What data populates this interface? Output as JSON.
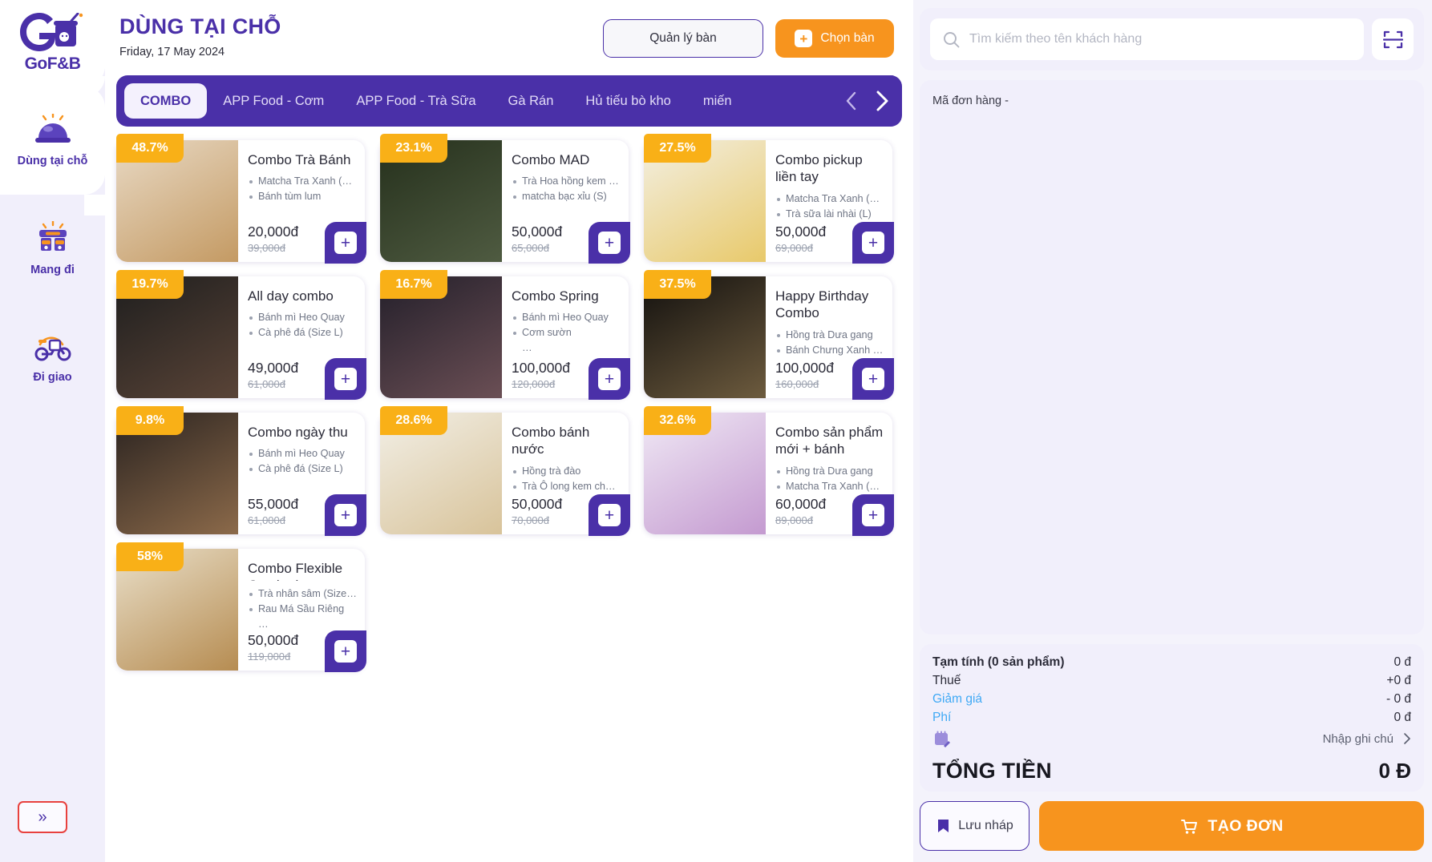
{
  "brand": {
    "name": "GoF&B",
    "logo_icon": "gofnb-logo-icon"
  },
  "sidebar": {
    "items": [
      {
        "label": "Dùng tại chỗ",
        "icon": "dine-in-icon",
        "active": true
      },
      {
        "label": "Mang đi",
        "icon": "takeaway-icon",
        "active": false
      },
      {
        "label": "Đi giao",
        "icon": "delivery-icon",
        "active": false
      }
    ],
    "expand_label": "»"
  },
  "header": {
    "title": "DÙNG TẠI CHỖ",
    "date": "Friday, 17 May 2024",
    "manage_table_label": "Quản lý bàn",
    "choose_table_label": "Chọn bàn"
  },
  "tabs": [
    {
      "label": "COMBO",
      "active": true
    },
    {
      "label": "APP Food - Cơm",
      "active": false
    },
    {
      "label": "APP Food - Trà Sữa",
      "active": false
    },
    {
      "label": "Gà Rán",
      "active": false
    },
    {
      "label": "Hủ tiếu bò kho",
      "active": false
    },
    {
      "label": "miến",
      "active": false
    }
  ],
  "products": [
    {
      "discount": "48.7%",
      "name": "Combo Trà Bánh",
      "options": [
        "Matcha Tra Xanh (Size S)",
        "Bánh tùm lum"
      ],
      "price": "20,000đ",
      "old_price": "39,000đ",
      "img_from": "#e8d9c4",
      "img_to": "#c49a63"
    },
    {
      "discount": "23.1%",
      "name": "Combo MAD",
      "options": [
        "Trà Hoa hồng kem che…",
        "matcha bạc xỉu (S)"
      ],
      "price": "50,000đ",
      "old_price": "65,000đ",
      "img_from": "#25301c",
      "img_to": "#4f5b41"
    },
    {
      "discount": "27.5%",
      "name": "Combo pickup liền tay",
      "options": [
        "Matcha Tra Xanh (Size S)",
        "Trà sữa lài nhài (L)"
      ],
      "price": "50,000đ",
      "old_price": "69,000đ",
      "img_from": "#f3efe2",
      "img_to": "#e8c96a"
    },
    {
      "discount": "19.7%",
      "name": "All day combo",
      "options": [
        "Bánh mì Heo Quay",
        "Cà phê đá (Size L)"
      ],
      "price": "49,000đ",
      "old_price": "61,000đ",
      "img_from": "#1e1e1e",
      "img_to": "#5a4437"
    },
    {
      "discount": "16.7%",
      "name": "Combo Spring",
      "options": [
        "Bánh mì Heo Quay",
        "Cơm sườn",
        "…"
      ],
      "price": "100,000đ",
      "old_price": "120,000đ",
      "img_from": "#231f2a",
      "img_to": "#6b4f55"
    },
    {
      "discount": "37.5%",
      "name": "Happy Birthday Combo",
      "options": [
        "Hồng trà Dưa gang",
        "Bánh Chưng Xanh (Bán…"
      ],
      "price": "100,000đ",
      "old_price": "160,000đ",
      "img_from": "#12100e",
      "img_to": "#6d5b3e"
    },
    {
      "discount": "9.8%",
      "name": "Combo ngày thu",
      "options": [
        "Bánh mì Heo Quay",
        "Cà phê đá (Size L)"
      ],
      "price": "55,000đ",
      "old_price": "61,000đ",
      "img_from": "#2a2320",
      "img_to": "#8c6a4a"
    },
    {
      "discount": "28.6%",
      "name": "Combo bánh nước",
      "options": [
        "Hồng trà đào",
        "Trà Ô long kem chees…"
      ],
      "price": "50,000đ",
      "old_price": "70,000đ",
      "img_from": "#f2efe6",
      "img_to": "#d8c39a"
    },
    {
      "discount": "32.6%",
      "name": "Combo sản phẩm mới + bánh",
      "options": [
        "Hồng trà Dưa gang",
        "Matcha Tra Xanh (Size S)"
      ],
      "price": "60,000đ",
      "old_price": "89,000đ",
      "img_from": "#f0e9f5",
      "img_to": "#c49ad0"
    },
    {
      "discount": "58%",
      "name": "Combo Flexible Combo long text…",
      "options": [
        "Trà nhân sâm (Size L)",
        "Rau Má Sầu Riêng",
        "…"
      ],
      "price": "50,000đ",
      "old_price": "119,000đ",
      "img_from": "#e9dfc9",
      "img_to": "#b68c51"
    }
  ],
  "right_panel": {
    "search_placeholder": "Tìm kiếm theo tên khách hàng",
    "search_value": "",
    "scan_icon": "scan-qr-icon",
    "order_code_label": "Mã đơn hàng",
    "order_code_value": "-"
  },
  "summary": {
    "rows": [
      {
        "label": "Tạm tính  (0 sản phẩm)",
        "value": "0 đ",
        "style": "bold"
      },
      {
        "label": "Thuế",
        "value": "+0 đ",
        "style": "normal"
      },
      {
        "label": "Giảm giá",
        "value": "- 0 đ",
        "style": "link"
      },
      {
        "label": "Phí",
        "value": "0 đ",
        "style": "link"
      }
    ],
    "note_icon": "note-edit-icon",
    "note_label": "Nhập ghi chú",
    "total_label": "TỔNG TIỀN",
    "total_value": "0 Đ",
    "draft_label": "Lưu nháp",
    "draft_icon": "bookmark-icon",
    "create_label": "TẠO ĐƠN",
    "create_icon": "cart-icon"
  },
  "colors": {
    "purple": "#4a30a8",
    "orange": "#f7941e",
    "badge_yellow": "#f9b017",
    "lavender": "#f1effb",
    "link_blue": "#3fa9f5"
  }
}
